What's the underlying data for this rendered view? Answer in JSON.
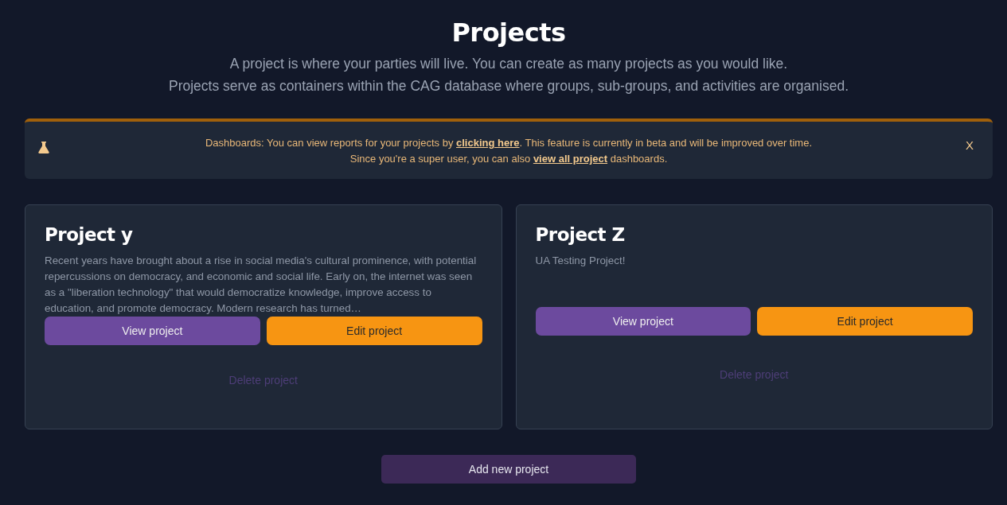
{
  "header": {
    "title": "Projects",
    "subtitle_lines": [
      "A project is where your parties will live. You can create as many projects as you would like.",
      "Projects serve as containers within the CAG database where groups, sub-groups, and activities are organised."
    ]
  },
  "notice": {
    "lines": [
      {
        "before": "Dashboards: You can view reports for your projects by ",
        "link": "clicking here",
        "after": ". This feature is currently in beta and will be improved over time."
      },
      {
        "before": "Since you're a super user, you can also ",
        "link": "view all project",
        "after": " dashboards."
      }
    ],
    "close": "X"
  },
  "projects": [
    {
      "name": "Project y",
      "description": "Recent years have brought about a rise in social media's cultural prominence, with potential repercussions on democracy, and economic and social life. Early on, the internet was seen as a \"liberation technology\" that would democratize knowledge, improve access to education, and promote democracy. Modern research has turned…",
      "view": "View project",
      "edit": "Edit project",
      "delete": "Delete project"
    },
    {
      "name": "Project Z",
      "description": "UA Testing Project!",
      "view": "View project",
      "edit": "Edit project",
      "delete": "Delete project"
    }
  ],
  "add_button": "Add new project"
}
